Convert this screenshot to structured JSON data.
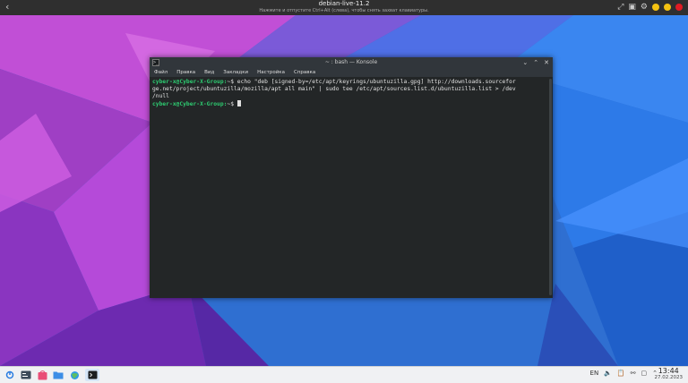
{
  "vm": {
    "title": "debian-live-11.2",
    "subtitle": "Нажмите и отпустите Ctrl+Alt (слева), чтобы снять захват клавиатуры.",
    "icons": [
      "back-chevron-icon",
      "fullscreen-icon",
      "screenshot-icon",
      "settings-icon"
    ],
    "dot_colors": [
      "#f5c211",
      "#f5c211",
      "#e01b24"
    ]
  },
  "konsole": {
    "title": "~ : bash — Konsole",
    "menu": [
      "Файл",
      "Правка",
      "Вид",
      "Закладки",
      "Настройка",
      "Справка"
    ],
    "lines": [
      {
        "prompt": "cyber-x@Cyber-X-Group:",
        "path": "~$",
        "command": " echo \"deb [signed-by=/etc/apt/keyrings/ubuntuzilla.gpg] http://downloads.sourcefor"
      },
      {
        "text": "ge.net/project/ubuntuzilla/mozilla/apt all main\" | sudo tee /etc/apt/sources.list.d/ubuntuzilla.list > /dev"
      },
      {
        "text": "/null"
      },
      {
        "prompt": "cyber-x@Cyber-X-Group:",
        "path": "~$",
        "command": " "
      }
    ]
  },
  "taskbar": {
    "apps": [
      "app-launcher-icon",
      "system-settings-icon",
      "app-store-icon",
      "file-manager-icon",
      "browser-icon",
      "konsole-icon"
    ],
    "tray": {
      "lang": "EN",
      "icons": [
        "volume-icon",
        "clipboard-icon",
        "usb-icon",
        "network-icon",
        "tray-expand-icon"
      ]
    },
    "clock": {
      "time": "13:44",
      "date": "27.02.2023"
    }
  }
}
